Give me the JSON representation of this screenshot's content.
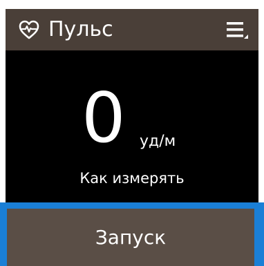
{
  "header": {
    "title": "Пульс",
    "icon": "heart-pulse-icon",
    "menu_icon": "menu-icon"
  },
  "reading": {
    "value": "0",
    "unit": "уд/м"
  },
  "howto_label": "Как измерять",
  "start_label": "Запуск",
  "colors": {
    "header_bg": "#4a3f38",
    "body_bg": "#000000",
    "focus_border": "#1a7fd6",
    "button_bg": "#5a4e46"
  }
}
